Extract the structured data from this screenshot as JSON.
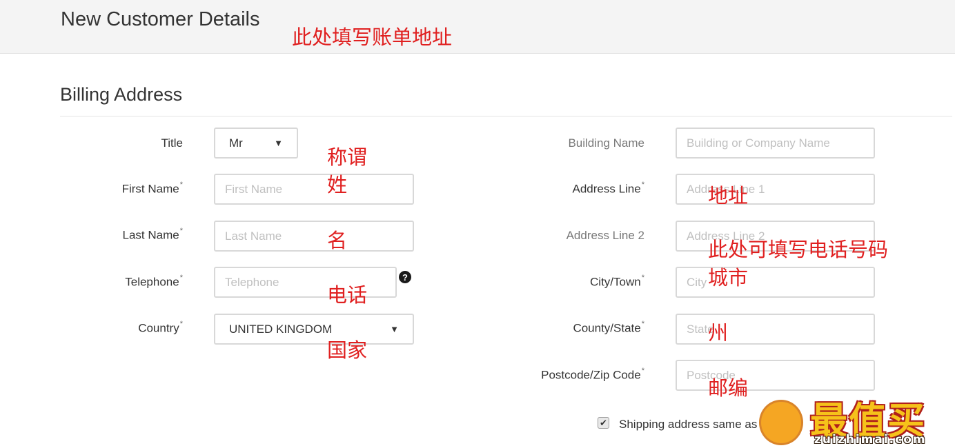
{
  "header": {
    "title": "New Customer Details"
  },
  "section": {
    "title": "Billing Address"
  },
  "left_fields": {
    "title": {
      "label": "Title",
      "value": "Mr"
    },
    "first_name": {
      "label": "First Name",
      "placeholder": "First Name"
    },
    "last_name": {
      "label": "Last Name",
      "placeholder": "Last Name"
    },
    "telephone": {
      "label": "Telephone",
      "placeholder": "Telephone",
      "help_icon": "?"
    },
    "country": {
      "label": "Country",
      "value": "UNITED KINGDOM"
    }
  },
  "right_fields": {
    "building_name": {
      "label": "Building Name",
      "placeholder": "Building or Company Name"
    },
    "address_line1": {
      "label": "Address Line",
      "placeholder": "Address Line 1"
    },
    "address_line2": {
      "label": "Address Line 2",
      "placeholder": "Address Line 2"
    },
    "city": {
      "label": "City/Town",
      "placeholder": "City"
    },
    "county": {
      "label": "County/State",
      "placeholder": "State"
    },
    "postcode": {
      "label": "Postcode/Zip Code",
      "placeholder": "Postcode"
    }
  },
  "required_marker": "*",
  "shipping_checkbox": {
    "label": "Shipping address same as",
    "checked": true
  },
  "annotations": {
    "billing": "此处填写账单地址",
    "title": "称谓",
    "surname": "姓",
    "given_name": "名",
    "phone": "电话",
    "country": "国家",
    "address": "地址",
    "phone_here": "此处可填写电话号码",
    "city": "城市",
    "state": "州",
    "postcode": "邮编"
  },
  "watermark": {
    "text": "最值买",
    "url": "zuizhimai.com"
  },
  "icons": {
    "select_caret": "chevron-down-icon",
    "help": "question-circle-icon",
    "checkbox": "check-icon"
  },
  "colors": {
    "annotation": "#e02020",
    "topbar": "#f4f4f4",
    "border": "#d8d8d8"
  }
}
